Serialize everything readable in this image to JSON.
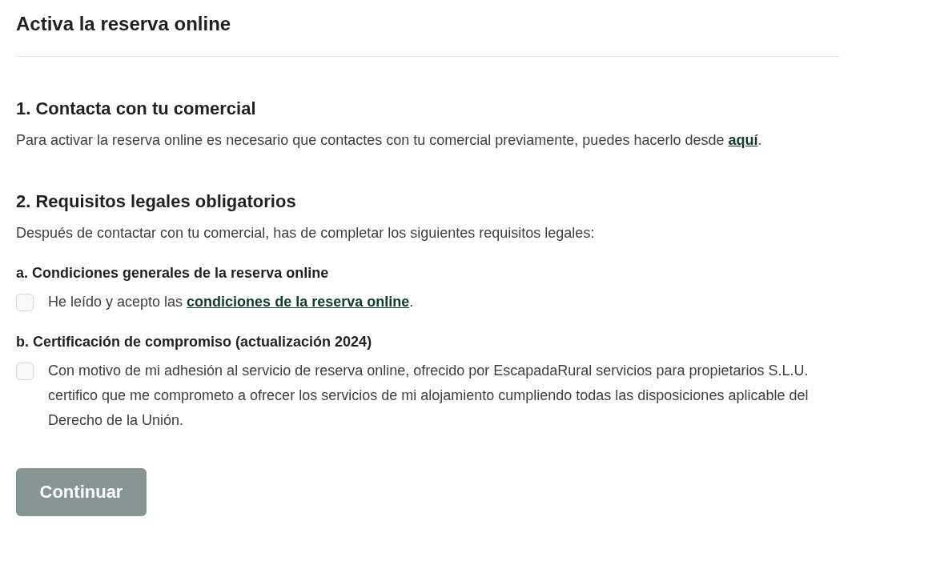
{
  "title": "Activa la reserva online",
  "step1": {
    "heading": "1. Contacta con tu comercial",
    "text_before": "Para activar la reserva online es necesario que contactes con tu comercial previamente, puedes hacerlo desde ",
    "link": "aquí",
    "text_after": "."
  },
  "step2": {
    "heading": "2. Requisitos legales obligatorios",
    "intro": "Después de contactar con tu comercial, has de completar los siguientes requisitos legales:",
    "requirements": [
      {
        "heading": "a. Condiciones generales de la reserva online",
        "checked": false,
        "label_before": "He leído y acepto las ",
        "link": "condiciones de la reserva online",
        "label_after": "."
      },
      {
        "heading": "b. Certificación de compromiso (actualización 2024)",
        "checked": false,
        "label_before": "Con motivo de mi adhesión al servicio de reserva online, ofrecido por EscapadaRural servicios para propietarios S.L.U. certifico que me comprometo a ofrecer los servicios de mi alojamiento cumpliendo todas las disposiciones aplicable del Derecho de la Unión."
      }
    ]
  },
  "button": {
    "label": "Continuar",
    "disabled": true
  }
}
